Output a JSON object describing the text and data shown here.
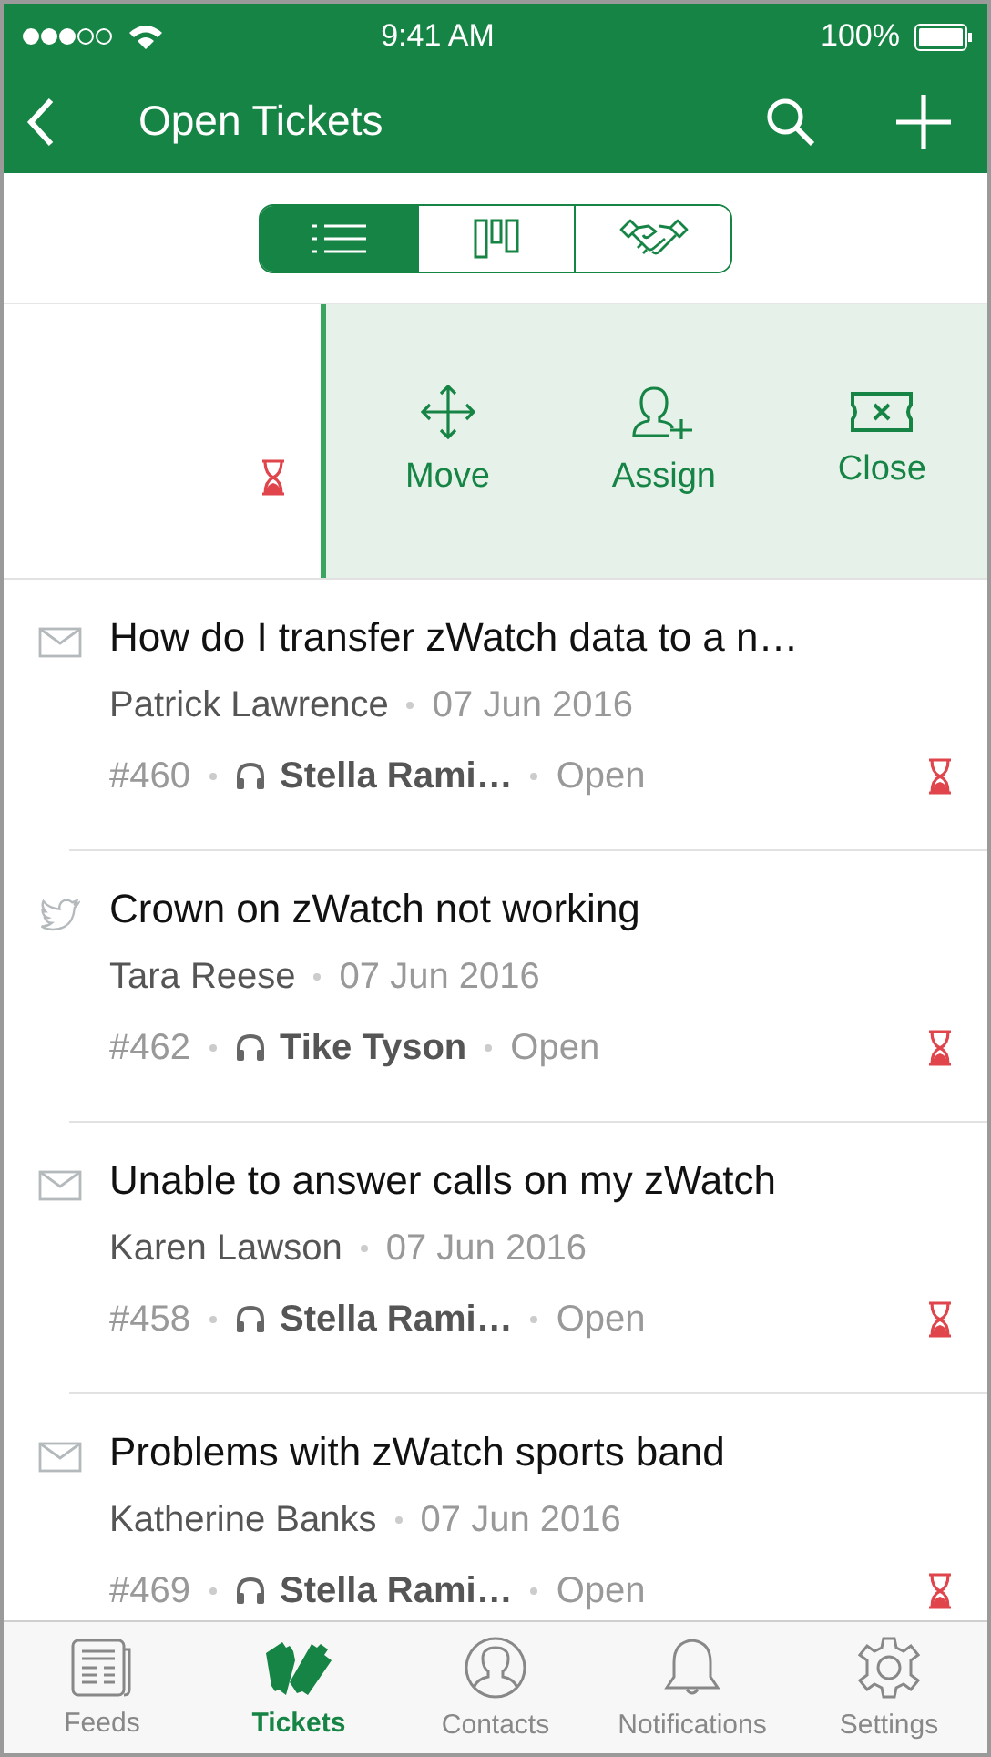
{
  "status_bar": {
    "time": "9:41 AM",
    "battery": "100%"
  },
  "nav": {
    "title": "Open Tickets"
  },
  "view_switch": [
    {
      "kind": "list",
      "selected": true
    },
    {
      "kind": "board",
      "selected": false
    },
    {
      "kind": "deal",
      "selected": false
    }
  ],
  "swipe_actions": [
    {
      "kind": "move",
      "label": "Move"
    },
    {
      "kind": "assign",
      "label": "Assign"
    },
    {
      "kind": "close",
      "label": "Close"
    }
  ],
  "tickets": [
    {
      "kind": "email",
      "subject": "How do I transfer zWatch data to a n…",
      "contact": "Patrick Lawrence",
      "date": "07 Jun 2016",
      "number": "#460",
      "agent": "Stella Rami…",
      "status": "Open"
    },
    {
      "kind": "twitter",
      "subject": "Crown on zWatch not working",
      "contact": "Tara Reese",
      "date": "07 Jun 2016",
      "number": "#462",
      "agent": "Tike Tyson",
      "status": "Open"
    },
    {
      "kind": "email",
      "subject": "Unable to answer calls on my zWatch",
      "contact": "Karen Lawson",
      "date": "07 Jun 2016",
      "number": "#458",
      "agent": "Stella Rami…",
      "status": "Open"
    },
    {
      "kind": "email",
      "subject": "Problems with zWatch sports band",
      "contact": "Katherine Banks",
      "date": "07 Jun 2016",
      "number": "#469",
      "agent": "Stella Rami…",
      "status": "Open"
    }
  ],
  "tab_bar": [
    {
      "kind": "feeds",
      "label": "Feeds",
      "selected": false
    },
    {
      "kind": "tickets",
      "label": "Tickets",
      "selected": true
    },
    {
      "kind": "contacts",
      "label": "Contacts",
      "selected": false
    },
    {
      "kind": "notifications",
      "label": "Notifications",
      "selected": false
    },
    {
      "kind": "settings",
      "label": "Settings",
      "selected": false
    }
  ]
}
